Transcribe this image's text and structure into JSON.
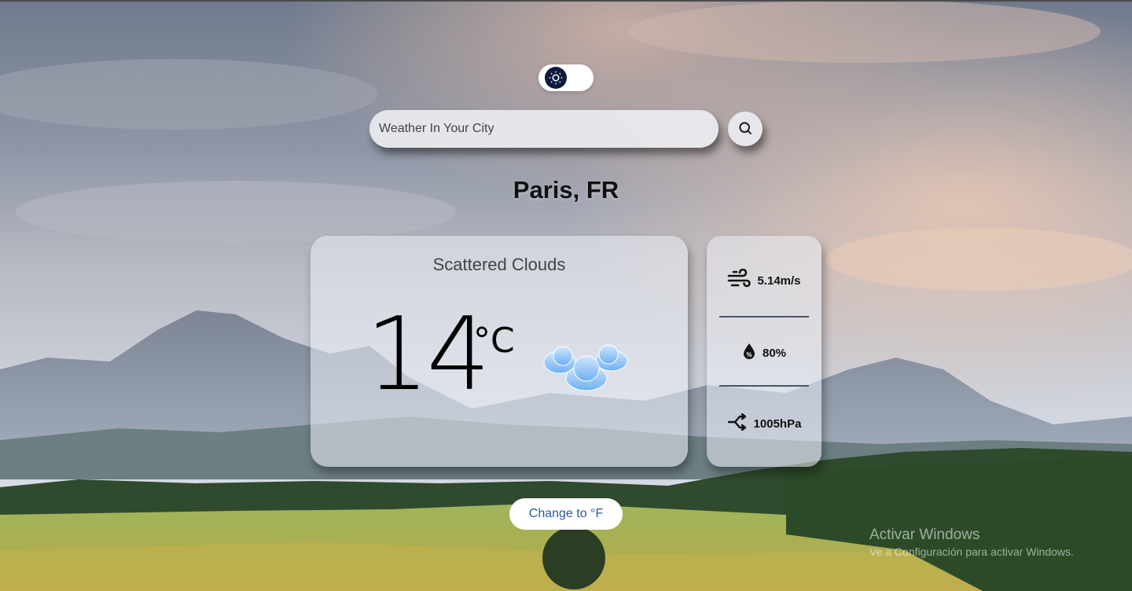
{
  "theme_toggle": {
    "icon": "sun-icon"
  },
  "search": {
    "placeholder": "Weather In Your City",
    "button_icon": "search-icon"
  },
  "location": {
    "city": "Paris, FR"
  },
  "current": {
    "description": "Scattered Clouds",
    "temperature": "14",
    "unit": "°C",
    "icon": "clouds-icon"
  },
  "details": {
    "wind": {
      "icon": "wind-icon",
      "value": "5.14m/s"
    },
    "humidity": {
      "icon": "humidity-icon",
      "value": "80%"
    },
    "pressure": {
      "icon": "pressure-icon",
      "value": "1005hPa"
    }
  },
  "unit_toggle": {
    "label": "Change to °F"
  },
  "watermark": {
    "title": "Activar Windows",
    "subtitle": "Ve a Configuración para activar Windows."
  },
  "colors": {
    "toggle_knob": "#0f1b3d",
    "unit_button_text": "#2c5aa0",
    "card_bg": "rgba(235,238,245,0.55)"
  }
}
